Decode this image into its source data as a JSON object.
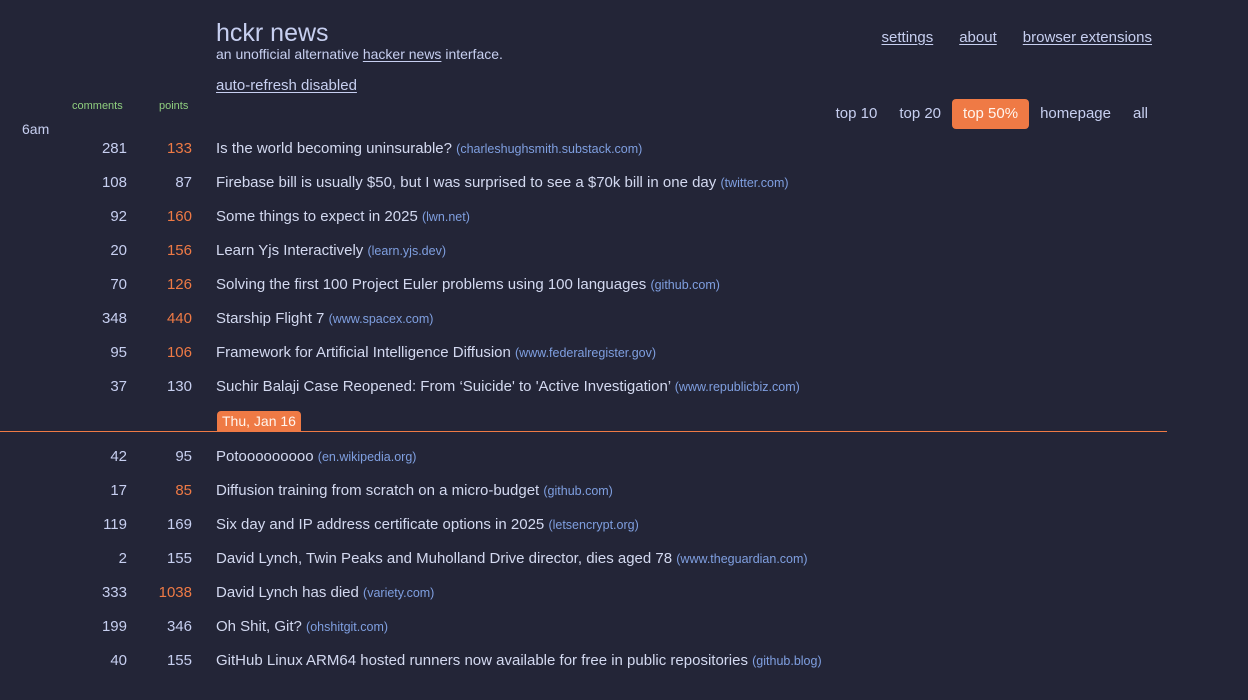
{
  "header": {
    "title": "hckr news",
    "tagline_prefix": "an unofficial alternative ",
    "tagline_link": "hacker news",
    "tagline_suffix": " interface.",
    "auto_refresh": "auto-refresh disabled"
  },
  "top_links": [
    {
      "label": "settings"
    },
    {
      "label": "about"
    },
    {
      "label": "browser extensions"
    }
  ],
  "filters": [
    {
      "label": "top 10",
      "active": false
    },
    {
      "label": "top 20",
      "active": false
    },
    {
      "label": "top 50%",
      "active": true
    },
    {
      "label": "homepage",
      "active": false
    },
    {
      "label": "all",
      "active": false
    }
  ],
  "columns": {
    "comments": "comments",
    "points": "points"
  },
  "colors": {
    "accent": "#ef7a45",
    "background": "#232537",
    "domain": "#7f9fe0",
    "column_header": "#8fcf7f"
  },
  "time_label": "6am",
  "date_separator": "Thu, Jan 16",
  "stories_before": [
    {
      "comments": "281",
      "points": "133",
      "hot": true,
      "title": "Is the world becoming uninsurable?",
      "domain": "(charleshughsmith.substack.com)"
    },
    {
      "comments": "108",
      "points": "87",
      "hot": false,
      "title": "Firebase bill is usually $50, but I was surprised to see a $70k bill in one day",
      "domain": "(twitter.com)"
    },
    {
      "comments": "92",
      "points": "160",
      "hot": true,
      "title": "Some things to expect in 2025",
      "domain": "(lwn.net)"
    },
    {
      "comments": "20",
      "points": "156",
      "hot": true,
      "title": "Learn Yjs Interactively",
      "domain": "(learn.yjs.dev)"
    },
    {
      "comments": "70",
      "points": "126",
      "hot": true,
      "title": "Solving the first 100 Project Euler problems using 100 languages",
      "domain": "(github.com)"
    },
    {
      "comments": "348",
      "points": "440",
      "hot": true,
      "title": "Starship Flight 7",
      "domain": "(www.spacex.com)"
    },
    {
      "comments": "95",
      "points": "106",
      "hot": true,
      "title": "Framework for Artificial Intelligence Diffusion",
      "domain": "(www.federalregister.gov)"
    },
    {
      "comments": "37",
      "points": "130",
      "hot": false,
      "title": "Suchir Balaji Case Reopened: From ‘Suicide' to 'Active Investigation’",
      "domain": "(www.republicbiz.com)"
    }
  ],
  "stories_after": [
    {
      "comments": "42",
      "points": "95",
      "hot": false,
      "title": "Potooooooooo",
      "domain": "(en.wikipedia.org)"
    },
    {
      "comments": "17",
      "points": "85",
      "hot": true,
      "title": "Diffusion training from scratch on a micro-budget",
      "domain": "(github.com)"
    },
    {
      "comments": "119",
      "points": "169",
      "hot": false,
      "title": "Six day and IP address certificate options in 2025",
      "domain": "(letsencrypt.org)"
    },
    {
      "comments": "2",
      "points": "155",
      "hot": false,
      "title": "David Lynch, Twin Peaks and Muholland Drive director, dies aged 78",
      "domain": "(www.theguardian.com)"
    },
    {
      "comments": "333",
      "points": "1038",
      "hot": true,
      "title": "David Lynch has died",
      "domain": "(variety.com)"
    },
    {
      "comments": "199",
      "points": "346",
      "hot": false,
      "title": "Oh Shit, Git?",
      "domain": "(ohshitgit.com)"
    },
    {
      "comments": "40",
      "points": "155",
      "hot": false,
      "title": "GitHub Linux ARM64 hosted runners now available for free in public repositories",
      "domain": "(github.blog)"
    }
  ]
}
